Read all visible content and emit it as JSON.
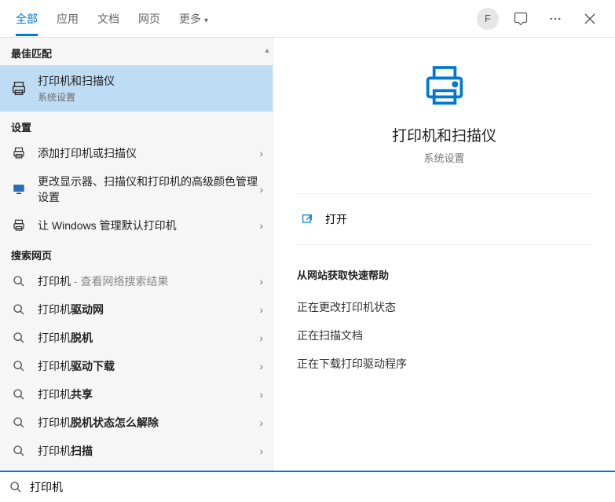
{
  "tabs": {
    "all": "全部",
    "apps": "应用",
    "docs": "文档",
    "web": "网页",
    "more": "更多"
  },
  "avatar": "F",
  "sections": {
    "best": "最佳匹配",
    "settings": "设置",
    "web": "搜索网页"
  },
  "best_result": {
    "title": "打印机和扫描仪",
    "subtitle": "系统设置"
  },
  "settings_items": [
    {
      "title": "添加打印机或扫描仪"
    },
    {
      "title": "更改显示器、扫描仪和打印机的高级颜色管理设置"
    },
    {
      "title": "让 Windows 管理默认打印机"
    }
  ],
  "web_prefix": "打印机",
  "web_hint": " - 查看网络搜索结果",
  "web_items": [
    {
      "suffix": ""
    },
    {
      "suffix": "驱动网"
    },
    {
      "suffix": "脱机"
    },
    {
      "suffix": "驱动下载"
    },
    {
      "suffix": "共享"
    },
    {
      "suffix": "脱机状态怎么解除"
    },
    {
      "suffix": "扫描"
    }
  ],
  "preview": {
    "title": "打印机和扫描仪",
    "subtitle": "系统设置",
    "open": "打开",
    "help_header": "从网站获取快速帮助",
    "help_links": [
      "正在更改打印机状态",
      "正在扫描文档",
      "正在下载打印驱动程序"
    ]
  },
  "search_value": "打印机"
}
